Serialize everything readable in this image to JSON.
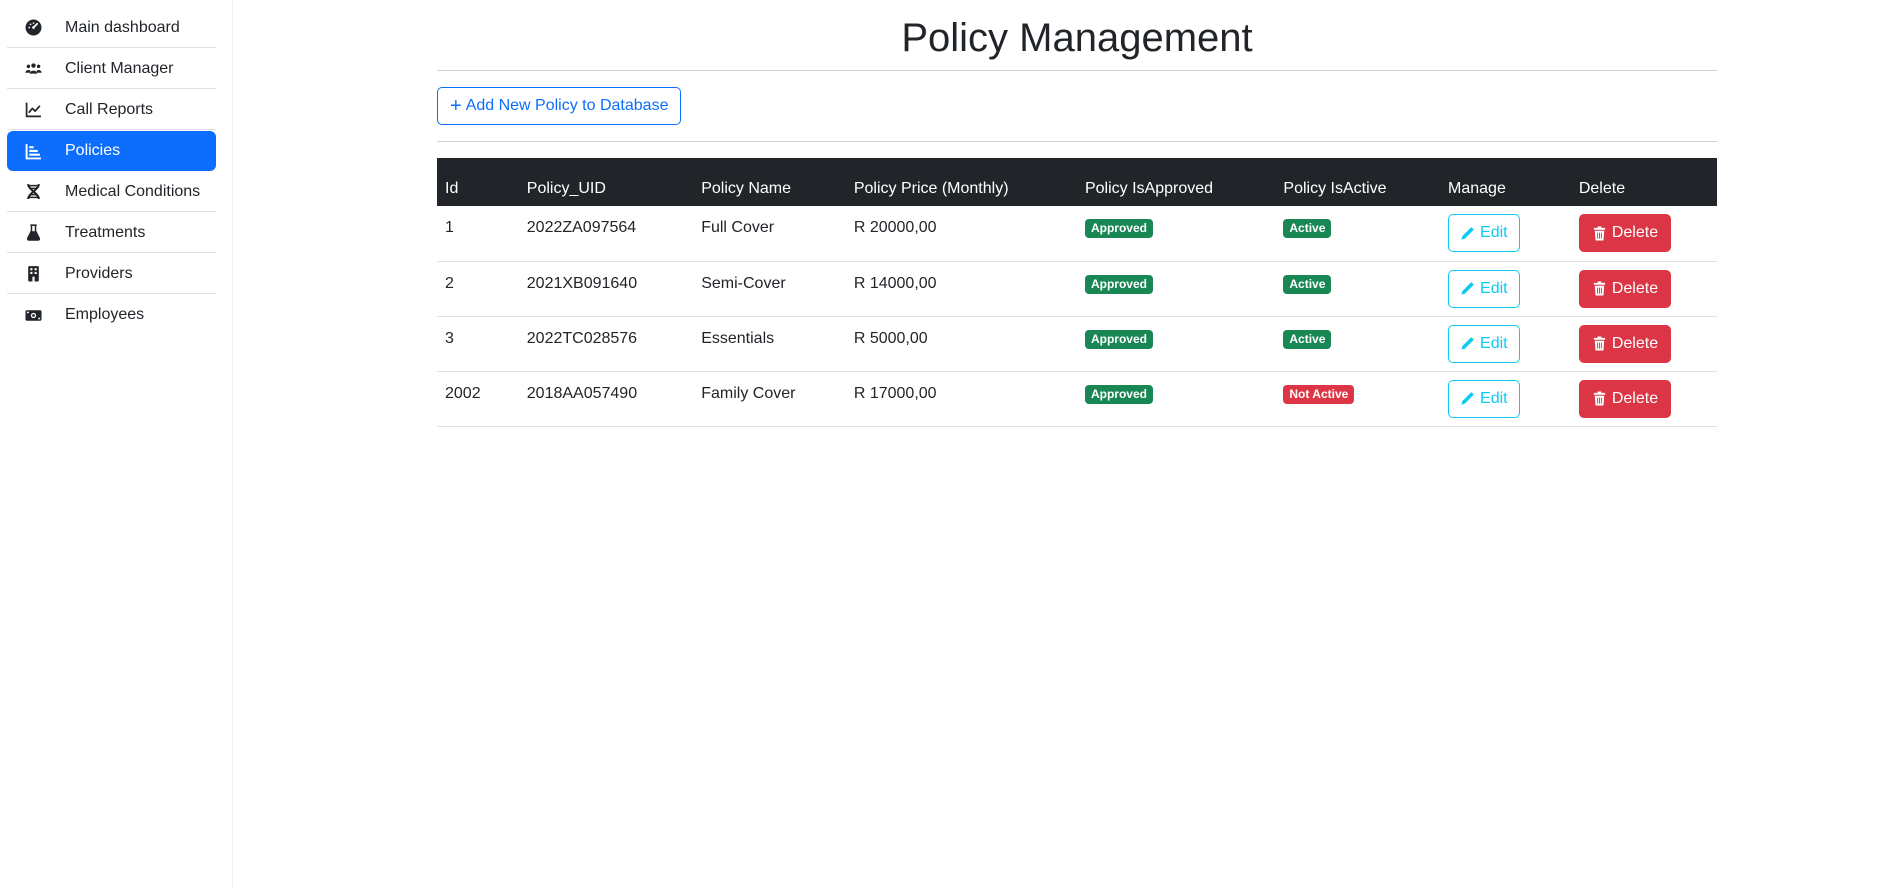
{
  "sidebar": {
    "items": [
      {
        "label": "Main dashboard",
        "icon": "gauge-icon",
        "active": false
      },
      {
        "label": "Client Manager",
        "icon": "users-icon",
        "active": false
      },
      {
        "label": "Call Reports",
        "icon": "line-chart-icon",
        "active": false
      },
      {
        "label": "Policies",
        "icon": "bar-list-icon",
        "active": true
      },
      {
        "label": "Medical Conditions",
        "icon": "dna-icon",
        "active": false
      },
      {
        "label": "Treatments",
        "icon": "flask-icon",
        "active": false
      },
      {
        "label": "Providers",
        "icon": "building-icon",
        "active": false
      },
      {
        "label": "Employees",
        "icon": "money-bill-icon",
        "active": false
      }
    ]
  },
  "page": {
    "title": "Policy Management",
    "add_button_label": "Add New Policy to Database"
  },
  "table": {
    "headers": [
      "Id",
      "Policy_UID",
      "Policy Name",
      "Policy Price (Monthly)",
      "Policy IsApproved",
      "Policy IsActive",
      "Manage",
      "Delete"
    ],
    "rows": [
      {
        "id": "1",
        "uid": "2022ZA097564",
        "name": "Full Cover",
        "price": "R 20000,00",
        "approved": "Approved",
        "active": "Active"
      },
      {
        "id": "2",
        "uid": "2021XB091640",
        "name": "Semi-Cover",
        "price": "R 14000,00",
        "approved": "Approved",
        "active": "Active"
      },
      {
        "id": "3",
        "uid": "2022TC028576",
        "name": "Essentials",
        "price": "R 5000,00",
        "approved": "Approved",
        "active": "Active"
      },
      {
        "id": "2002",
        "uid": "2018AA057490",
        "name": "Family Cover",
        "price": "R 17000,00",
        "approved": "Approved",
        "active": "Not Active"
      }
    ],
    "edit_label": "Edit",
    "delete_label": "Delete"
  },
  "colors": {
    "primary": "#0d6efd",
    "success": "#198754",
    "danger": "#dc3545",
    "info": "#0dcaf0",
    "dark": "#212529"
  }
}
